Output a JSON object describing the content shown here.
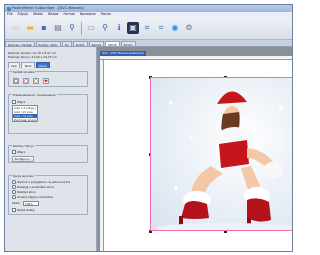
{
  "window": {
    "title": "PosterMaker Subscriber - [DVC Maxxen]"
  },
  "menu": {
    "items": [
      "Plik",
      "Edycja",
      "Widok",
      "Wstaw",
      "Format",
      "Narzędzia",
      "Pomoc"
    ]
  },
  "toolbar": {
    "buttons": [
      {
        "name": "new-document-icon",
        "glyph": "▭",
        "color": "#ffffff"
      },
      {
        "name": "open-folder-icon",
        "glyph": "▬",
        "color": "#f0b429"
      },
      {
        "name": "save-icon",
        "glyph": "▪",
        "color": "#3b6fc4"
      },
      {
        "name": "print-icon",
        "glyph": "▤",
        "color": "#6b7890"
      },
      {
        "name": "zoom-icon",
        "glyph": "⚲",
        "color": "#2d5fa8"
      },
      {
        "name": "scanner-icon",
        "glyph": "▭",
        "color": "#8a94a8"
      },
      {
        "name": "zoom-in-icon",
        "glyph": "⚲",
        "color": "#2d5fa8"
      },
      {
        "name": "info-icon",
        "glyph": "ℹ",
        "color": "#3b6fc4"
      },
      {
        "name": "monitor-icon",
        "glyph": "▣",
        "color": "#1e2c4a"
      },
      {
        "name": "crop-icon",
        "glyph": "⌗",
        "color": "#2d5fa8"
      },
      {
        "name": "fit-page-icon",
        "glyph": "⌗",
        "color": "#3b6fc4"
      },
      {
        "name": "globe-icon",
        "glyph": "◉",
        "color": "#2f8fd8"
      },
      {
        "name": "settings-icon",
        "glyph": "⚙",
        "color": "#6b7890"
      }
    ]
  },
  "tabs": {
    "items": [
      "Rozmiar / Kształt",
      "Rodzaj / Wzór",
      "Tło",
      "Profile",
      "Ramka",
      "OPCJE",
      "Pomoc"
    ],
    "active_index": 5
  },
  "left_panel": {
    "info_line_1": "Rozmiar obrazu: 12,70 x 8,47 cm",
    "info_line_2": "Rozmiar strony: 21,00 x 29,70 cm",
    "subtabs": [
      "Kadr",
      "Tekst",
      "Opcje"
    ],
    "active_subtab": 2,
    "shape_group": {
      "title": "Kształt obrazka"
    },
    "resize_group": {
      "title": "Przeskalowanie / dopasowanie",
      "checkbox_label": "Włącz",
      "list": [
        "Auto 1:1 (Oryg.)",
        "Auto / 2x pow.",
        "Auto / 3x pow.",
        "Zachowaj proporcje"
      ],
      "selected_index": 2
    },
    "frame_group": {
      "title": "Ramka / Obrys",
      "checkbox_label": "Włącz",
      "button_label": "Konfiguruj..."
    },
    "print_group": {
      "title": "Opcje wydruku",
      "option_1": "Wydruk z podglądem na jednej kartce",
      "option_2": "Rozwijaj z podziałem stron",
      "option_3": "Rozkład stron",
      "option_4": "Umieść zdjęcie centralnie",
      "zoom_label": "Skala",
      "zoom_value": "100%",
      "checkbox_label": "Pokaż siatkę"
    }
  },
  "document": {
    "tab_label": "DVC - [DVC Maxxen-Subscribe]"
  }
}
